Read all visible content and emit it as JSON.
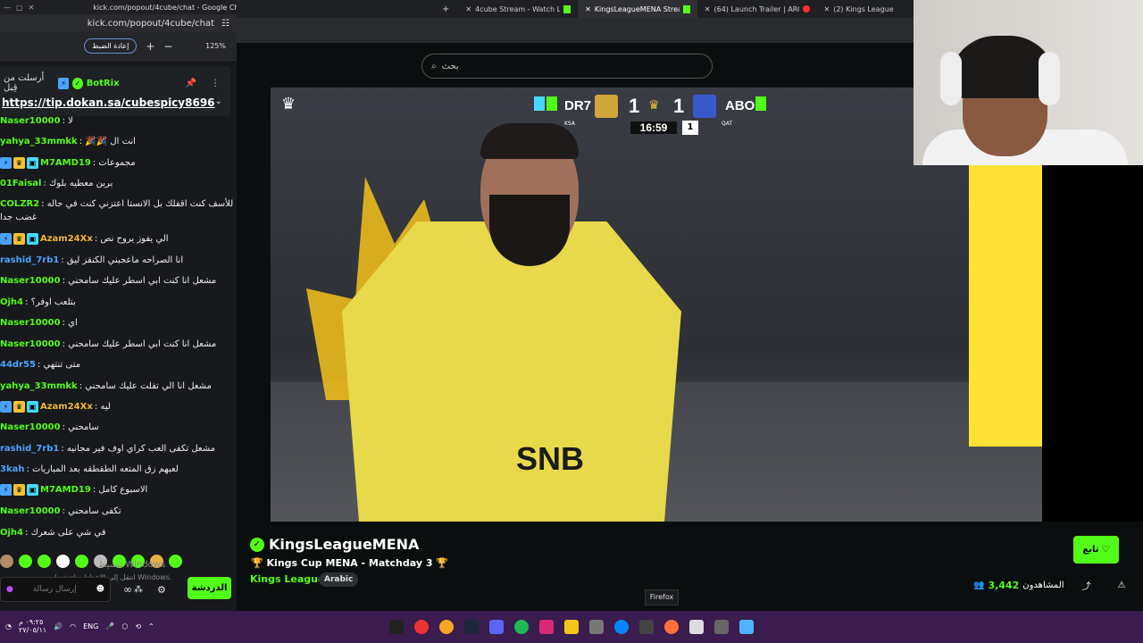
{
  "popout": {
    "title": "kick.com/popout/4cube/chat - Google Chrome",
    "url": "kick.com/popout/4cube/chat",
    "reset_label": "إعادة الضبط",
    "zoom_plus": "+",
    "zoom_minus": "−",
    "zoom_value": "125%"
  },
  "pinned": {
    "sent_by": "أرسلت من قِبل",
    "user": "BotRix",
    "link": "https://tip.dokan.sa/cubespicy8696"
  },
  "chat_messages": [
    {
      "user": "Naser10000",
      "color": "#53fc18",
      "text": ": لا",
      "badges": false
    },
    {
      "user": "yahya_33mmkk",
      "color": "#53fc18",
      "text": ": 🎉🎉 انت ال",
      "badges": false
    },
    {
      "user": "M7AMD19",
      "color": "#53fc18",
      "text": ": مجموعات",
      "badges": true
    },
    {
      "user": "01Faisal",
      "color": "#53fc18",
      "text": ": برين معطيه بلوك",
      "badges": false
    },
    {
      "user": "COLZR2",
      "color": "#53fc18",
      "text": ": انا للأسف كنت اقفلك بل الانستا اعتزني كنت في حاله",
      "badges": false
    },
    {
      "user": "",
      "color": "#eeeeee",
      "text": "غضب جدا",
      "badges": false
    },
    {
      "user": "Azam24Xx",
      "color": "#f2b632",
      "text": ": الي يفوز يروح نص",
      "badges": true
    },
    {
      "user": "rashid_7rb1",
      "color": "#4aa3ff",
      "text": ": انا الصراحه ماعجبني الكنقز ليق",
      "badges": false
    },
    {
      "user": "Naser10000",
      "color": "#53fc18",
      "text": ": مشعل انا كنت ابي اسطر عليك سامحني",
      "badges": false
    },
    {
      "user": "Ojh4",
      "color": "#53fc18",
      "text": ": بتلعب اوفر؟",
      "badges": false
    },
    {
      "user": "Naser10000",
      "color": "#53fc18",
      "text": ": اي",
      "badges": false
    },
    {
      "user": "Naser10000",
      "color": "#53fc18",
      "text": ": مشعل انا كنت ابي اسطر عليك سامحني",
      "badges": false
    },
    {
      "user": "44dr55",
      "color": "#4aa3ff",
      "text": ": متى تنتهي",
      "badges": false
    },
    {
      "user": "yahya_33mmkk",
      "color": "#53fc18",
      "text": ": مشعل انا الي تفلت عليك سامحني",
      "badges": false
    },
    {
      "user": "Azam24Xx",
      "color": "#f2b632",
      "text": ": ليه",
      "badges": true
    },
    {
      "user": "Naser10000",
      "color": "#53fc18",
      "text": ": سامحني",
      "badges": false
    },
    {
      "user": "rashid_7rb1",
      "color": "#4aa3ff",
      "text": ": مشعل تكفى العب كراي اوف فير مجانيه",
      "badges": false
    },
    {
      "user": "3kah",
      "color": "#4aa3ff",
      "text": ": لعبهم زق المتعه الطقطقه بعد المباريات",
      "badges": false
    },
    {
      "user": "M7AMD19",
      "color": "#53fc18",
      "text": ": الاسبوع كامل",
      "badges": true
    },
    {
      "user": "Naser10000",
      "color": "#53fc18",
      "text": ": تكفى سامحني",
      "badges": false
    },
    {
      "user": "Ojh4",
      "color": "#53fc18",
      "text": ": في شي على شعرك",
      "badges": false
    }
  ],
  "chat_input": {
    "placeholder": "إرسال رسالة",
    "send_label": "الدردشة"
  },
  "windows_watermark": {
    "line1": "تنشيط Windows",
    "line2": "انتقل إلى الإعدادات لتنشيط Windows."
  },
  "tabs": [
    {
      "label": "4cube Stream - Watch Live on K",
      "icon": "kick",
      "active": false
    },
    {
      "label": "KingsLeagueMENA Stream",
      "icon": "kick",
      "active": true
    },
    {
      "label": "(64) Launch Trailer | ARC Raider",
      "icon": "youtube",
      "active": false
    },
    {
      "label": "(2) Kings League",
      "icon": "none",
      "active": false
    }
  ],
  "site": {
    "search_placeholder": "بحث"
  },
  "scoreboard": {
    "home_team": "DR7",
    "home_score": "1",
    "away_team": "ABO",
    "away_score": "1",
    "clock": "16:59",
    "half": "1",
    "home_country": "KSA",
    "away_country": "QAT"
  },
  "video": {
    "sponsor_text": "SNB"
  },
  "stream": {
    "channel": "KingsLeagueMENA",
    "title": "🏆 Kings Cup MENA - Matchday 3 🏆",
    "category": "Kings League",
    "tag": "Arabic",
    "follow_label": "تابع",
    "viewers_label": "المشاهدون",
    "viewers_count": "3,442"
  },
  "tooltip": "Firefox",
  "taskbar": {
    "lang": "ENG",
    "time": "٠٩:٢٥ م",
    "date": "٢٧/٠٥/١١"
  },
  "colors": {
    "kick_green": "#53fc18",
    "taskbar_purple": "#3a1c4e"
  }
}
